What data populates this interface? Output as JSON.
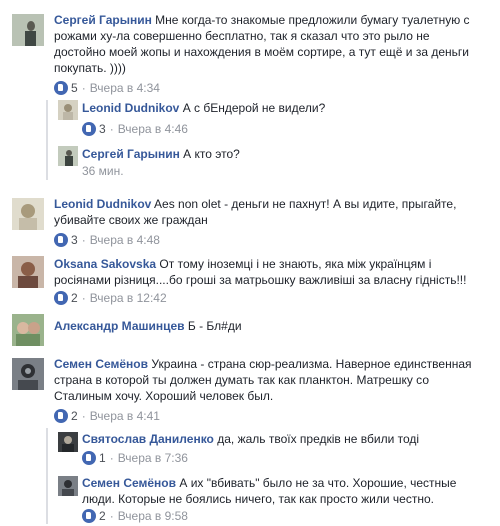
{
  "comments": [
    {
      "author": "Сергей Гарынин",
      "text": "Мне когда-то знакомые предложили бумагу туалетную с рожами ху-ла совершенно бесплатно, так я сказал что это рыло не достойно моей жопы и нахождения в моём сортире, а тут ещё и за деньги покупать. ))))",
      "likes": "5",
      "time": "Вчера в 4:34"
    },
    {
      "author": "Leonid Dudnikov",
      "text": "А с бЕндерой не видели?",
      "likes": "3",
      "time": "Вчера в 4:46"
    },
    {
      "author": "Сергей Гарынин",
      "text": "А кто это?",
      "likes": "",
      "time": "36 мин."
    },
    {
      "author": "Leonid Dudnikov",
      "text": "Aes non olet - деньги не пахнут! А вы идите, прыгайте, убивайте своих же граждан",
      "likes": "3",
      "time": "Вчера в 4:48"
    },
    {
      "author": "Oksana Sakovska",
      "text": "От тому іноземці і не знають, яка між українцям і росіянами різниця....бо гроші за матрьошку важливіші за власну гідність!!!",
      "likes": "2",
      "time": "Вчера в 12:42"
    },
    {
      "author": "Александр Машинцев",
      "text": "Б - Бл#ди",
      "likes": "",
      "time": ""
    },
    {
      "author": "Семен Семёнов",
      "text": "Украина - страна сюр-реализма. Наверное единственная страна в которой ты должен думать так как планктон. Матрешку со Сталиным хочу. Хороший человек был.",
      "likes": "2",
      "time": "Вчера в 4:41"
    },
    {
      "author": "Святослав Даниленко",
      "text": "да, жаль твоїх предків не вбили тоді",
      "likes": "1",
      "time": "Вчера в 7:36"
    },
    {
      "author": "Семен Семёнов",
      "text": "А их \"вбивать\" было не за что. Хорошие, честные люди. Которые не боялись ничего, так как просто жили честно.",
      "likes": "2",
      "time": "Вчера в 9:58"
    }
  ],
  "colors": {
    "author": "#365899",
    "meta": "#90949c",
    "like": "#4267b2"
  }
}
